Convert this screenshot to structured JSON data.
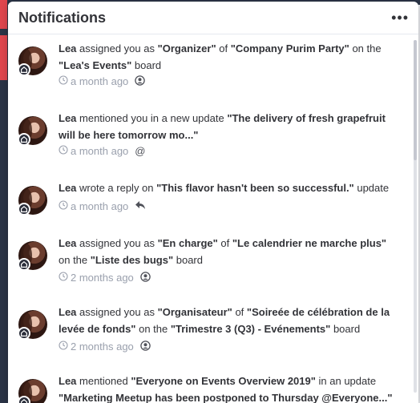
{
  "header": {
    "title": "Notifications",
    "more_label": "•••"
  },
  "notifications": [
    {
      "user": "Lea",
      "parts": [
        " assigned you as ",
        "\"Organizer\"",
        " of ",
        "\"Company Purim Party\"",
        " on the ",
        "\"Lea's Events\"",
        " board"
      ],
      "time": "a month ago",
      "type_icon": "person-icon"
    },
    {
      "user": "Lea",
      "parts": [
        " mentioned you in a new update ",
        "\"The delivery of fresh grapefruit will be here tomorrow mo...\""
      ],
      "time": "a month ago",
      "type_icon": "mention-icon",
      "type_glyph": "@"
    },
    {
      "user": "Lea",
      "parts": [
        " wrote a reply on ",
        "\"This flavor hasn't been so successful.\"",
        " update"
      ],
      "time": "a month ago",
      "type_icon": "reply-icon"
    },
    {
      "user": "Lea",
      "parts": [
        " assigned you as ",
        "\"En charge\"",
        " of ",
        "\"Le calendrier ne marche plus\"",
        " on the ",
        "\"Liste des bugs\"",
        " board"
      ],
      "time": "2 months ago",
      "type_icon": "person-icon"
    },
    {
      "user": "Lea",
      "parts": [
        " assigned you as ",
        "\"Organisateur\"",
        " of ",
        "\"Soireée de célébration de la levée de fonds\"",
        " on the ",
        "\"Trimestre 3 (Q3) - Evénements\"",
        " board"
      ],
      "time": "2 months ago",
      "type_icon": "person-icon"
    },
    {
      "user": "Lea",
      "parts": [
        " mentioned ",
        "\"Everyone on Events Overview 2019\"",
        " in an update ",
        "\"Marketing Meetup has been postponed to Thursday @Everyone...\""
      ],
      "time": "",
      "type_icon": ""
    }
  ],
  "colors": {
    "accent": "#e0464e",
    "sidebar": "#2b3446",
    "text": "#323338",
    "muted": "#9aa0ad"
  }
}
